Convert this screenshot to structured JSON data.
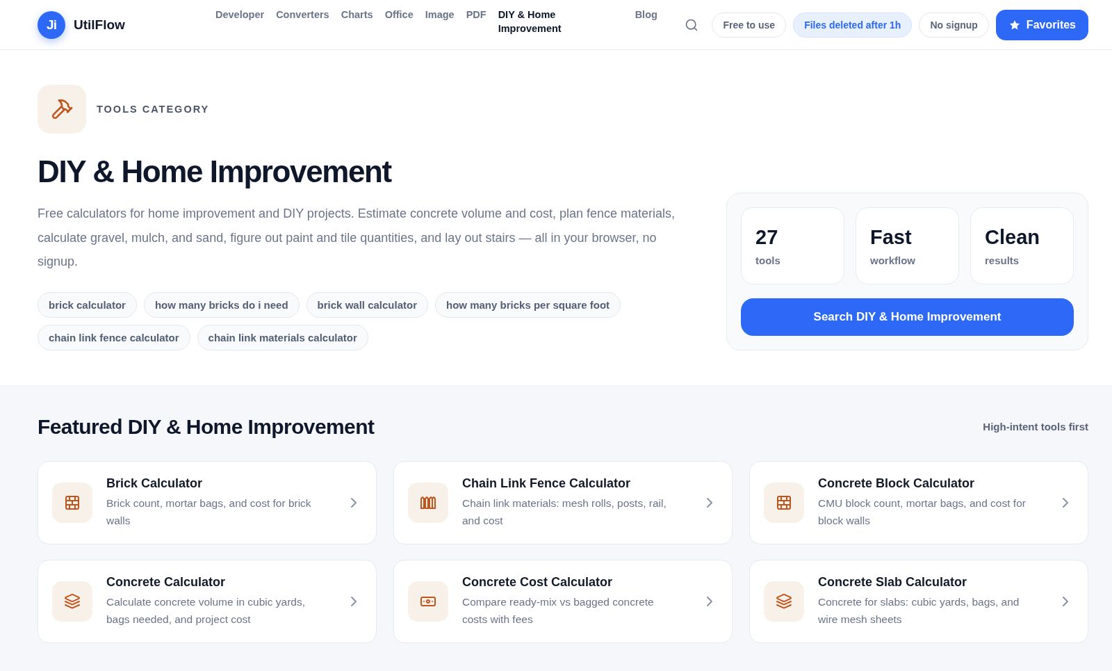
{
  "header": {
    "logo_mark": "Ji",
    "brand": "UtilFlow",
    "nav": [
      {
        "label": "Developer",
        "selected": false
      },
      {
        "label": "Converters",
        "selected": false
      },
      {
        "label": "Charts",
        "selected": false
      },
      {
        "label": "Office",
        "selected": false
      },
      {
        "label": "Image",
        "selected": false
      },
      {
        "label": "PDF",
        "selected": false
      },
      {
        "label": "DIY & Home Improvement",
        "selected": true
      },
      {
        "label": "Blog",
        "selected": false
      }
    ],
    "badges": [
      {
        "label": "Free to use",
        "highlighted": false
      },
      {
        "label": "Files deleted after 1h",
        "highlighted": true
      },
      {
        "label": "No signup",
        "highlighted": false
      }
    ],
    "favorites_button": "Favorites"
  },
  "hero": {
    "eyebrow": "TOOLS CATEGORY",
    "title": "DIY & Home Improvement",
    "description": "Free calculators for home improvement and DIY projects. Estimate concrete volume and cost, plan fence materials, calculate gravel, mulch, and sand, figure out paint and tile quantities, and lay out stairs — all in your browser, no signup.",
    "tags": [
      "brick calculator",
      "how many bricks do i need",
      "brick wall calculator",
      "how many bricks per square foot",
      "chain link fence calculator",
      "chain link materials calculator"
    ]
  },
  "stats_panel": {
    "stats": [
      {
        "value": "27",
        "label": "tools"
      },
      {
        "value": "Fast",
        "label": "workflow"
      },
      {
        "value": "Clean",
        "label": "results"
      }
    ],
    "search_button": "Search DIY & Home Improvement"
  },
  "featured": {
    "title": "Featured DIY & Home Improvement",
    "note": "High-intent tools first",
    "tools": [
      {
        "title": "Brick Calculator",
        "description": "Brick count, mortar bags, and cost for brick walls"
      },
      {
        "title": "Chain Link Fence Calculator",
        "description": "Chain link materials: mesh rolls, posts, rail, and cost"
      },
      {
        "title": "Concrete Block Calculator",
        "description": "CMU block count, mortar bags, and cost for block walls"
      },
      {
        "title": "Concrete Calculator",
        "description": "Calculate concrete volume in cubic yards, bags needed, and project cost"
      },
      {
        "title": "Concrete Cost Calculator",
        "description": "Compare ready-mix vs bagged concrete costs with fees"
      },
      {
        "title": "Concrete Slab Calculator",
        "description": "Concrete for slabs: cubic yards, bags, and wire mesh sheets"
      }
    ]
  }
}
